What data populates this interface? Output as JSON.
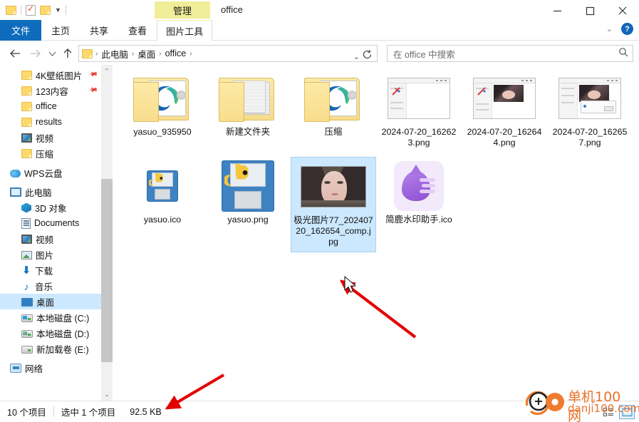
{
  "window": {
    "title": "office",
    "management_tab": "管理",
    "minimize": "minimize",
    "maximize": "maximize",
    "close": "close"
  },
  "quick_access": {
    "items": [
      "folder-icon",
      "properties-icon",
      "new-folder-icon",
      "dropdown-icon"
    ]
  },
  "ribbon": {
    "tabs": [
      {
        "label": "文件",
        "active": true
      },
      {
        "label": "主页",
        "active": false
      },
      {
        "label": "共享",
        "active": false
      },
      {
        "label": "查看",
        "active": false
      },
      {
        "label": "图片工具",
        "active": false
      }
    ],
    "collapse_label": "chevron-down-icon",
    "help_label": "?"
  },
  "address": {
    "back": "←",
    "forward": "→",
    "recent": "⌄",
    "up": "↑",
    "breadcrumbs": [
      "此电脑",
      "桌面",
      "office"
    ],
    "separator": "›",
    "dropdown": "⌄",
    "refresh": "refresh-icon"
  },
  "search": {
    "placeholder": "在 office 中搜索",
    "icon": "search-icon"
  },
  "sidebar": {
    "items": [
      {
        "label": "4K壁纸图片",
        "icon": "folder",
        "indent": 1,
        "pinned": true,
        "selected": false
      },
      {
        "label": "123内容",
        "icon": "folder",
        "indent": 1,
        "pinned": true,
        "selected": false
      },
      {
        "label": "office",
        "icon": "folder",
        "indent": 1,
        "pinned": false,
        "selected": false
      },
      {
        "label": "results",
        "icon": "folder",
        "indent": 1,
        "pinned": false,
        "selected": false
      },
      {
        "label": "视频",
        "icon": "video",
        "indent": 1,
        "pinned": false,
        "selected": false
      },
      {
        "label": "压缩",
        "icon": "folder",
        "indent": 1,
        "pinned": false,
        "selected": false
      },
      {
        "label": "WPS云盘",
        "icon": "cloud",
        "indent": 0,
        "pinned": false,
        "selected": false,
        "group": true
      },
      {
        "label": "此电脑",
        "icon": "pc",
        "indent": 0,
        "pinned": false,
        "selected": false,
        "group": true
      },
      {
        "label": "3D 对象",
        "icon": "3d",
        "indent": 1,
        "pinned": false,
        "selected": false
      },
      {
        "label": "Documents",
        "icon": "doc",
        "indent": 1,
        "pinned": false,
        "selected": false
      },
      {
        "label": "视频",
        "icon": "video",
        "indent": 1,
        "pinned": false,
        "selected": false
      },
      {
        "label": "图片",
        "icon": "pic",
        "indent": 1,
        "pinned": false,
        "selected": false
      },
      {
        "label": "下载",
        "icon": "down",
        "indent": 1,
        "pinned": false,
        "selected": false
      },
      {
        "label": "音乐",
        "icon": "music",
        "indent": 1,
        "pinned": false,
        "selected": false
      },
      {
        "label": "桌面",
        "icon": "desktop",
        "indent": 1,
        "pinned": false,
        "selected": true
      },
      {
        "label": "本地磁盘 (C:)",
        "icon": "drivec",
        "indent": 1,
        "pinned": false,
        "selected": false
      },
      {
        "label": "本地磁盘 (D:)",
        "icon": "drived",
        "indent": 1,
        "pinned": false,
        "selected": false
      },
      {
        "label": "新加载卷 (E:)",
        "icon": "drive",
        "indent": 1,
        "pinned": false,
        "selected": false
      },
      {
        "label": "网络",
        "icon": "net",
        "indent": 0,
        "pinned": false,
        "selected": false,
        "group": true
      }
    ],
    "scrollbar": {
      "up_arrow": "⌃",
      "down_arrow": "⌄"
    }
  },
  "files": [
    {
      "name": "yasuo_935950",
      "type": "folder-edge",
      "selected": false
    },
    {
      "name": "新建文件夹",
      "type": "folder-papers",
      "selected": false
    },
    {
      "name": "压缩",
      "type": "folder-edge",
      "selected": false
    },
    {
      "name": "2024-07-20_162623.png",
      "type": "screenshot-blank",
      "selected": false
    },
    {
      "name": "2024-07-20_162644.png",
      "type": "screenshot-face",
      "selected": false
    },
    {
      "name": "2024-07-20_162657.png",
      "type": "screenshot-dialog",
      "selected": false
    },
    {
      "name": "yasuo.ico",
      "type": "floppy-small",
      "selected": false
    },
    {
      "name": "yasuo.png",
      "type": "floppy-large",
      "selected": false
    },
    {
      "name": "极光图片77_20240720_162654_comp.jpg",
      "type": "portrait-photo",
      "selected": true
    },
    {
      "name": "简鹿水印助手.ico",
      "type": "app-drop",
      "selected": false
    }
  ],
  "status": {
    "item_count": "10 个项目",
    "selection": "选中 1 个项目",
    "size": "92.5 KB",
    "view_details": "details-view-icon",
    "view_large": "large-icons-view-icon"
  },
  "watermark": {
    "line1": "单机100网",
    "line2": "danji100.com"
  },
  "colors": {
    "accent": "#0f6cbd",
    "selection": "#cce8ff",
    "management_tab": "#f0ee98",
    "arrow": "#e30000",
    "watermark": "#e8722c"
  }
}
